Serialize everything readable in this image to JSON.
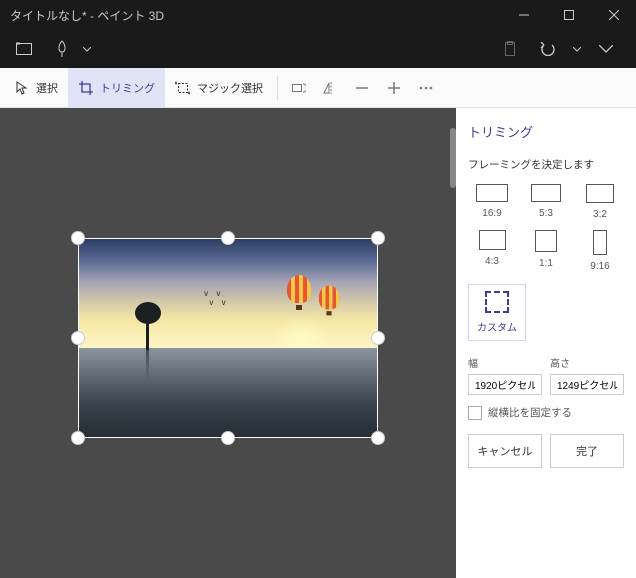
{
  "titlebar": {
    "title": "タイトルなし* - ペイント 3D"
  },
  "toolbar": {
    "select": "選択",
    "crop": "トリミング",
    "magic": "マジック選択"
  },
  "panel": {
    "title": "トリミング",
    "desc": "フレーミングを決定します",
    "ratios": {
      "r169": "16:9",
      "r53": "5:3",
      "r32": "3:2",
      "r43": "4:3",
      "r11": "1:1",
      "r916": "9:16"
    },
    "custom": "カスタム",
    "width_label": "幅",
    "height_label": "高さ",
    "width_value": "1920ピクセル",
    "height_value": "1249ピクセル",
    "lock_aspect": "縦横比を固定する",
    "cancel": "キャンセル",
    "done": "完了"
  }
}
